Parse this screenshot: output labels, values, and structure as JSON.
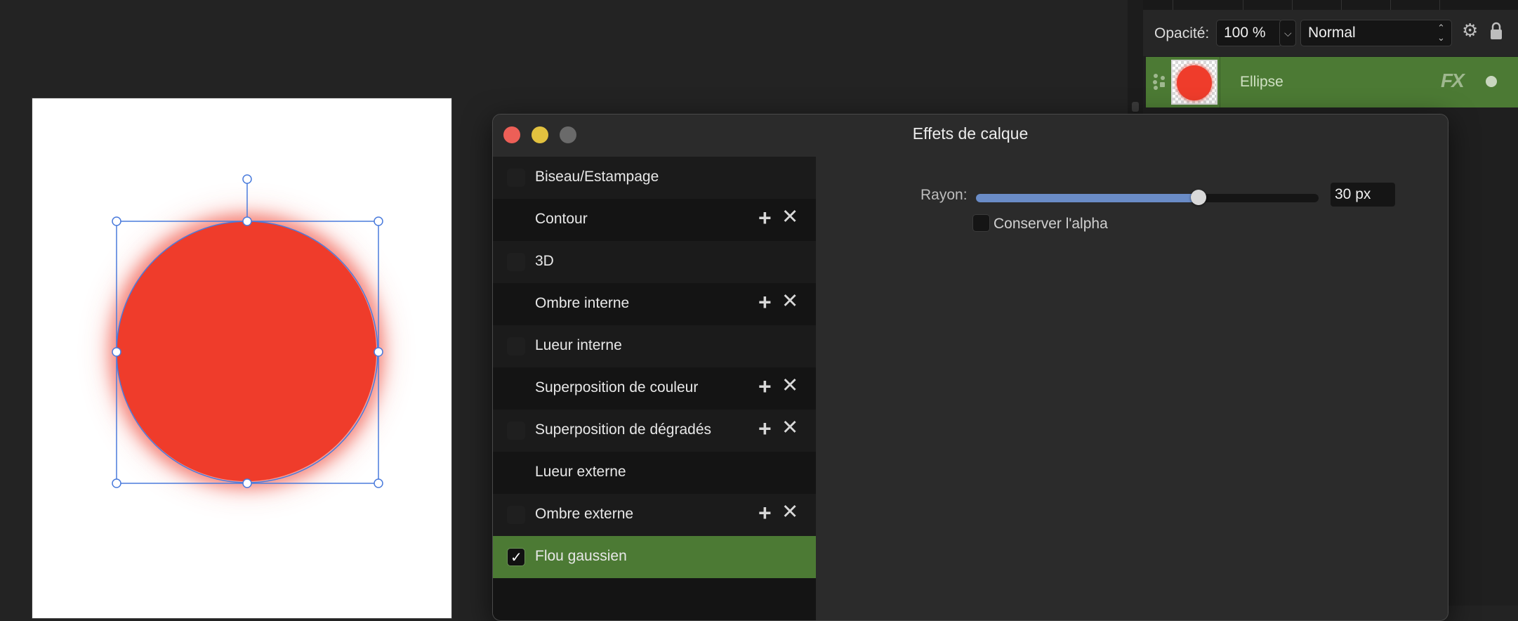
{
  "layers_panel": {
    "opacity_label": "Opacité:",
    "opacity_value": "100 %",
    "blend_mode": "Normal",
    "layer_name": "Ellipse",
    "fx_badge": "FX"
  },
  "dialog": {
    "title": "Effets de calque",
    "effects": [
      {
        "label": "Biseau/Estampage",
        "checked": false,
        "has_actions": false
      },
      {
        "label": "Contour",
        "checked": false,
        "has_actions": true
      },
      {
        "label": "3D",
        "checked": false,
        "has_actions": false
      },
      {
        "label": "Ombre interne",
        "checked": false,
        "has_actions": true
      },
      {
        "label": "Lueur interne",
        "checked": false,
        "has_actions": false
      },
      {
        "label": "Superposition de couleur",
        "checked": false,
        "has_actions": true
      },
      {
        "label": "Superposition de dégradés",
        "checked": false,
        "has_actions": true
      },
      {
        "label": "Lueur externe",
        "checked": false,
        "has_actions": false
      },
      {
        "label": "Ombre externe",
        "checked": false,
        "has_actions": true
      },
      {
        "label": "Flou gaussien",
        "checked": true,
        "has_actions": false
      }
    ],
    "settings": {
      "radius_label": "Rayon:",
      "radius_value": "30 px",
      "radius_fraction": 0.65,
      "preserve_alpha_label": "Conserver l'alpha",
      "preserve_alpha_checked": false
    }
  },
  "colors": {
    "accent_green": "#4c7a34",
    "ellipse_red": "#ef3c2b",
    "selection_blue": "#4a7bdc",
    "close": "#ed5f57",
    "minimize": "#e2c13f",
    "zoom": "#6a6a6a"
  }
}
